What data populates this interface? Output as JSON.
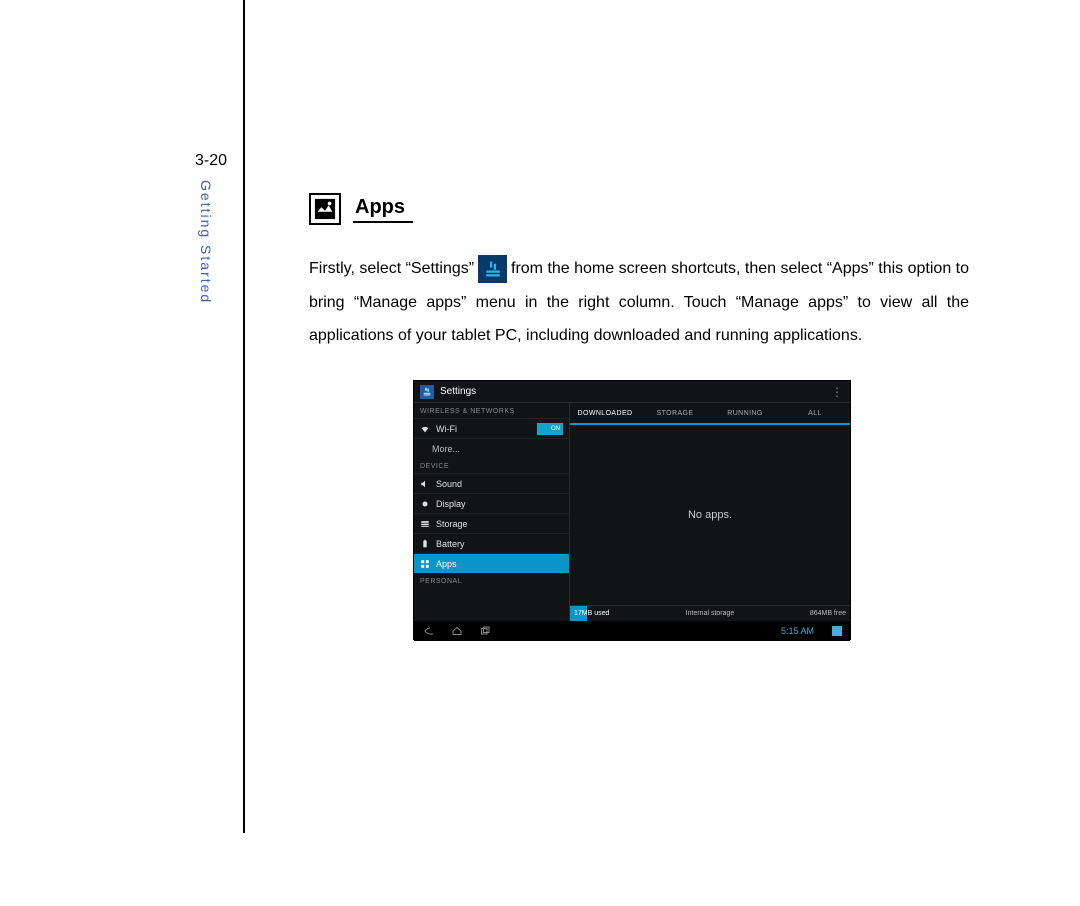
{
  "page": {
    "number": "3-20",
    "side_label": "Getting Started"
  },
  "heading": "Apps",
  "body": {
    "line1_a": "Firstly,  select  “Settings”",
    "line1_b": "from  the  home  screen  shortcuts,  then  select  “Apps”  this  option  to",
    "rest": "bring “Manage apps” menu in the right column. Touch “Manage apps” to view all the applications of your tablet PC, including downloaded and running applications."
  },
  "device": {
    "title": "Settings",
    "sections": {
      "wireless_header": "WIRELESS & NETWORKS",
      "device_header": "DEVICE",
      "personal_header": "PERSONAL"
    },
    "items": {
      "wifi": "Wi-Fi",
      "wifi_toggle": "ON",
      "more": "More...",
      "sound": "Sound",
      "display": "Display",
      "storage": "Storage",
      "battery": "Battery",
      "apps": "Apps"
    },
    "tabs": {
      "downloaded": "DOWNLOADED",
      "storage": "STORAGE",
      "running": "RUNNING",
      "all": "ALL"
    },
    "empty": "No apps.",
    "storage_bar": {
      "used": "17MB used",
      "label": "Internal storage",
      "free": "864MB free"
    },
    "clock": "5:15 AM"
  }
}
